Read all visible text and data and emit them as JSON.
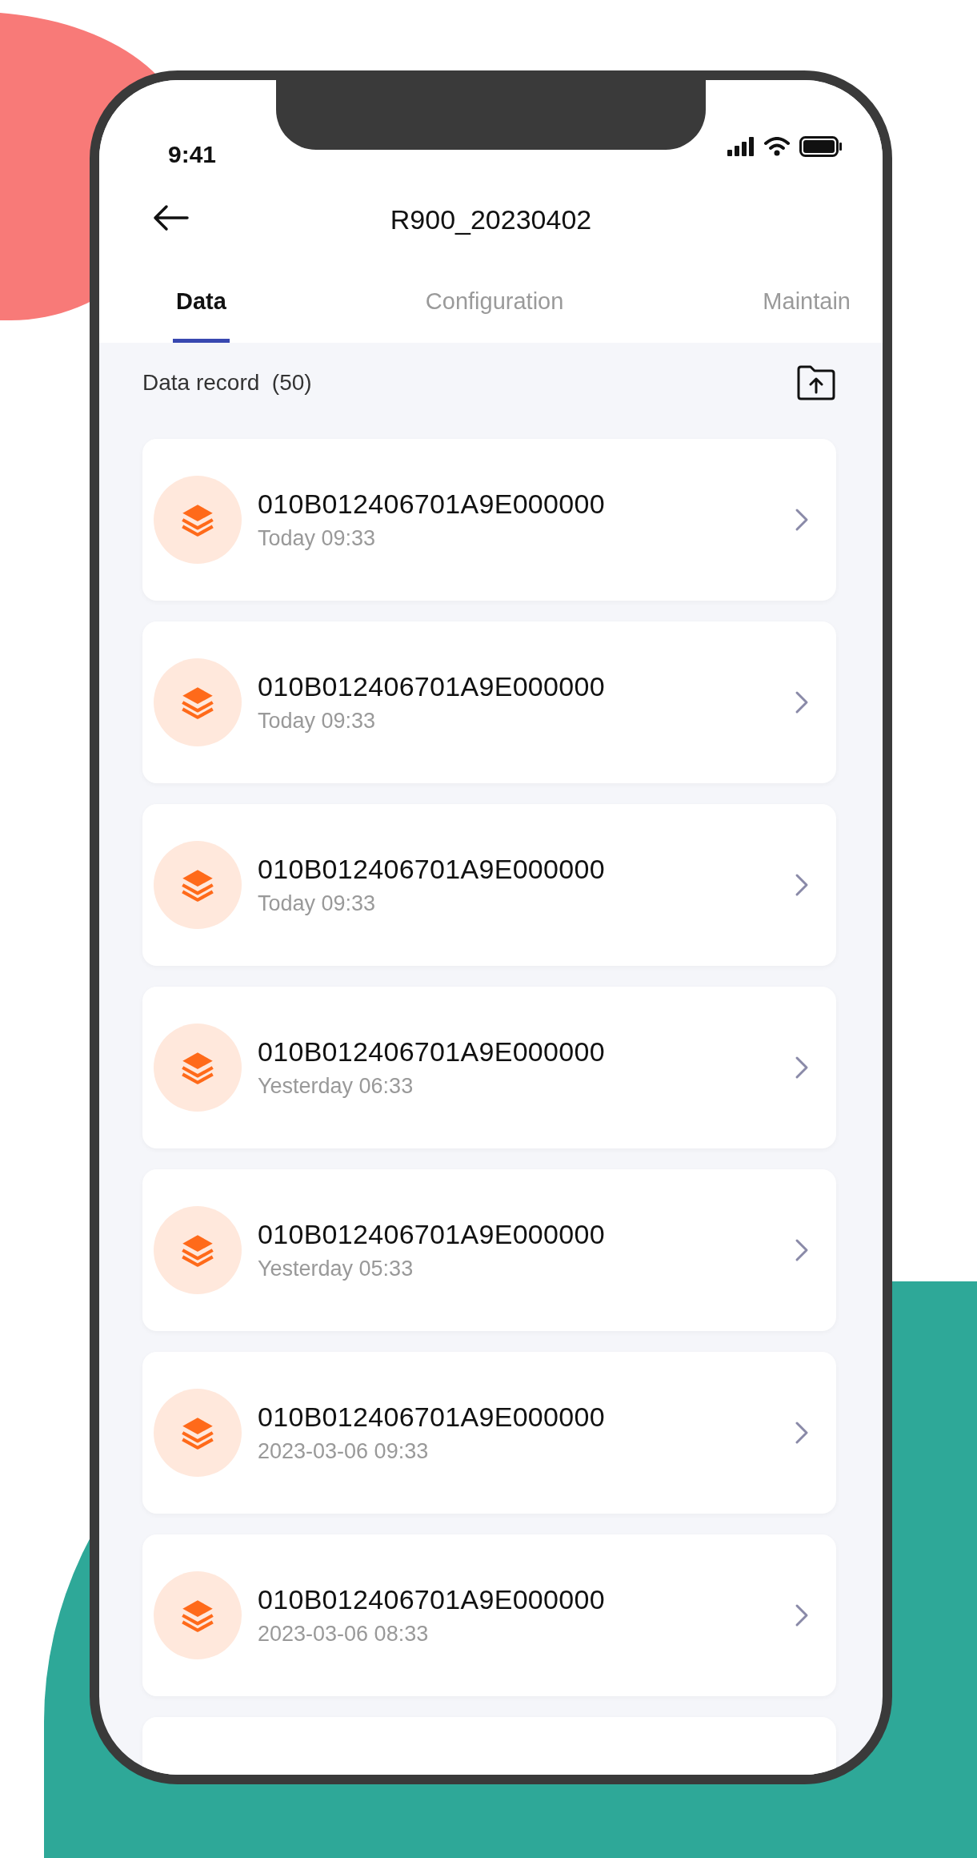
{
  "status_bar": {
    "time": "9:41"
  },
  "header": {
    "title": "R900_20230402"
  },
  "tabs": [
    {
      "label": "Data",
      "selected": true
    },
    {
      "label": "Configuration",
      "selected": false
    },
    {
      "label": "Maintain",
      "selected": false
    }
  ],
  "section": {
    "title": "Data record  (50)"
  },
  "records": [
    {
      "id": "010B012406701A9E000000",
      "time": "Today 09:33"
    },
    {
      "id": "010B012406701A9E000000",
      "time": "Today 09:33"
    },
    {
      "id": "010B012406701A9E000000",
      "time": "Today 09:33"
    },
    {
      "id": "010B012406701A9E000000",
      "time": "Yesterday 06:33"
    },
    {
      "id": "010B012406701A9E000000",
      "time": "Yesterday 05:33"
    },
    {
      "id": "010B012406701A9E000000",
      "time": "2023-03-06 09:33"
    },
    {
      "id": "010B012406701A9E000000",
      "time": "2023-03-06 08:33"
    }
  ]
}
